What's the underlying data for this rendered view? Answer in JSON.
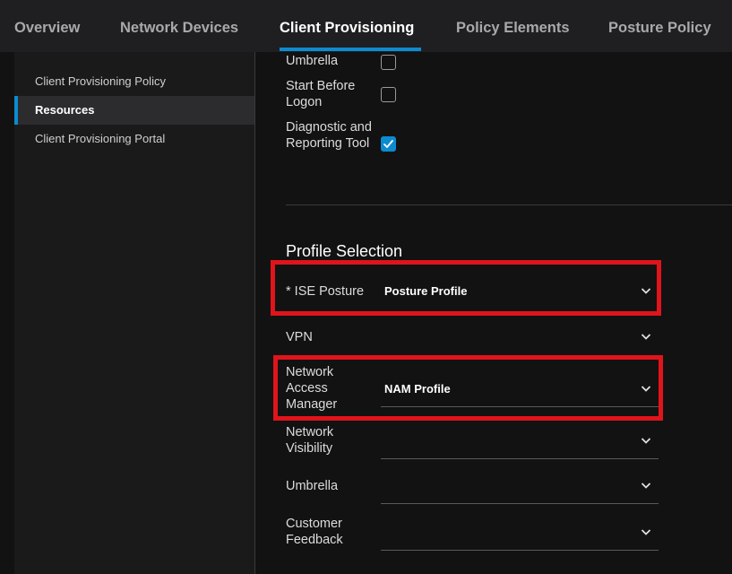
{
  "tabs": [
    {
      "label": "Overview",
      "active": false
    },
    {
      "label": "Network Devices",
      "active": false
    },
    {
      "label": "Client Provisioning",
      "active": true
    },
    {
      "label": "Policy Elements",
      "active": false
    },
    {
      "label": "Posture Policy",
      "active": false
    }
  ],
  "sidebar": {
    "items": [
      {
        "label": "Client Provisioning Policy",
        "active": false
      },
      {
        "label": "Resources",
        "active": true
      },
      {
        "label": "Client Provisioning Portal",
        "active": false
      }
    ]
  },
  "modules": [
    {
      "label": "Umbrella",
      "checked": false
    },
    {
      "label": "Start Before Logon",
      "checked": false
    },
    {
      "label": "Diagnostic and Reporting Tool",
      "checked": true
    }
  ],
  "profile_selection": {
    "title": "Profile Selection",
    "rows": [
      {
        "label": "* ISE Posture",
        "value": "Posture Profile"
      },
      {
        "label": "VPN",
        "value": ""
      },
      {
        "label": "Network Access Manager",
        "value": "NAM Profile"
      },
      {
        "label": "Network Visibility",
        "value": ""
      },
      {
        "label": "Umbrella",
        "value": ""
      },
      {
        "label": "Customer Feedback",
        "value": ""
      }
    ]
  },
  "colors": {
    "accent": "#0d8bd0",
    "highlight": "#e0141b",
    "background": "#121212"
  }
}
